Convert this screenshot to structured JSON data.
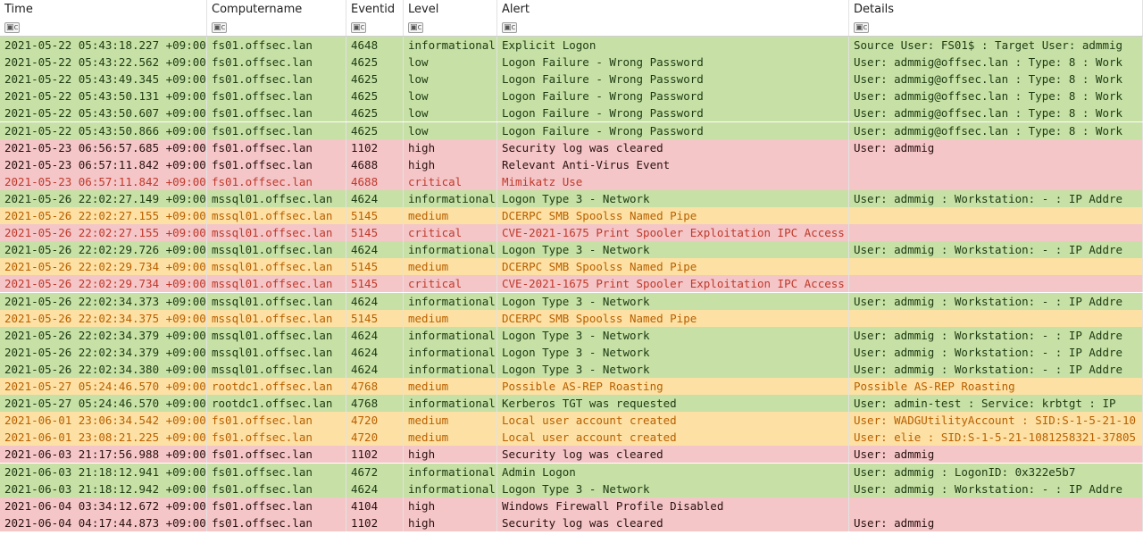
{
  "columns": [
    {
      "key": "time",
      "label": "Time"
    },
    {
      "key": "computer",
      "label": "Computername"
    },
    {
      "key": "eventid",
      "label": "Eventid"
    },
    {
      "key": "level",
      "label": "Level"
    },
    {
      "key": "alert",
      "label": "Alert"
    },
    {
      "key": "details",
      "label": "Details"
    }
  ],
  "filter_icon": "filter-icon",
  "level_colors": {
    "informational": {
      "bg": "#c6e0a5",
      "fg": "#1e3a12"
    },
    "low": {
      "bg": "#c6e0a5",
      "fg": "#1e3a12"
    },
    "high": {
      "bg": "#f4c6c8",
      "fg": "#2a1111"
    },
    "critical": {
      "bg": "#f4c6c8",
      "fg": "#c0392b"
    },
    "medium": {
      "bg": "#fde1a4",
      "fg": "#b85f00"
    }
  },
  "rows": [
    {
      "time": "2021-05-22 05:43:18.227 +09:00",
      "computer": "fs01.offsec.lan",
      "eventid": "4648",
      "level": "informational",
      "alert": "Explicit Logon",
      "details": "Source User: FS01$  :  Target User: admmig"
    },
    {
      "time": "2021-05-22 05:43:22.562 +09:00",
      "computer": "fs01.offsec.lan",
      "eventid": "4625",
      "level": "low",
      "alert": "Logon Failure - Wrong Password",
      "details": "User: admmig@offsec.lan  :  Type: 8  :  Work"
    },
    {
      "time": "2021-05-22 05:43:49.345 +09:00",
      "computer": "fs01.offsec.lan",
      "eventid": "4625",
      "level": "low",
      "alert": "Logon Failure - Wrong Password",
      "details": "User: admmig@offsec.lan  :  Type: 8  :  Work"
    },
    {
      "time": "2021-05-22 05:43:50.131 +09:00",
      "computer": "fs01.offsec.lan",
      "eventid": "4625",
      "level": "low",
      "alert": "Logon Failure - Wrong Password",
      "details": "User: admmig@offsec.lan  :  Type: 8  :  Work"
    },
    {
      "time": "2021-05-22 05:43:50.607 +09:00",
      "computer": "fs01.offsec.lan",
      "eventid": "4625",
      "level": "low",
      "alert": "Logon Failure - Wrong Password",
      "details": "User: admmig@offsec.lan  :  Type: 8  :  Work"
    },
    {
      "time": "2021-05-22 05:43:50.866 +09:00",
      "computer": "fs01.offsec.lan",
      "eventid": "4625",
      "level": "low",
      "alert": "Logon Failure - Wrong Password",
      "details": "User: admmig@offsec.lan  :  Type: 8  :  Work"
    },
    {
      "time": "2021-05-23 06:56:57.685 +09:00",
      "computer": "fs01.offsec.lan",
      "eventid": "1102",
      "level": "high",
      "alert": "Security log was cleared",
      "details": "User: admmig"
    },
    {
      "time": "2021-05-23 06:57:11.842 +09:00",
      "computer": "fs01.offsec.lan",
      "eventid": "4688",
      "level": "high",
      "alert": "Relevant Anti-Virus Event",
      "details": ""
    },
    {
      "time": "2021-05-23 06:57:11.842 +09:00",
      "computer": "fs01.offsec.lan",
      "eventid": "4688",
      "level": "critical",
      "alert": "Mimikatz Use",
      "details": ""
    },
    {
      "time": "2021-05-26 22:02:27.149 +09:00",
      "computer": "mssql01.offsec.lan",
      "eventid": "4624",
      "level": "informational",
      "alert": "Logon Type 3 - Network",
      "details": "User: admmig  :  Workstation: -  :  IP Addre"
    },
    {
      "time": "2021-05-26 22:02:27.155 +09:00",
      "computer": "mssql01.offsec.lan",
      "eventid": "5145",
      "level": "medium",
      "alert": "DCERPC SMB Spoolss Named Pipe",
      "details": ""
    },
    {
      "time": "2021-05-26 22:02:27.155 +09:00",
      "computer": "mssql01.offsec.lan",
      "eventid": "5145",
      "level": "critical",
      "alert": "CVE-2021-1675 Print Spooler Exploitation IPC Access",
      "details": ""
    },
    {
      "time": "2021-05-26 22:02:29.726 +09:00",
      "computer": "mssql01.offsec.lan",
      "eventid": "4624",
      "level": "informational",
      "alert": "Logon Type 3 - Network",
      "details": "User: admmig  :  Workstation: -  :  IP Addre"
    },
    {
      "time": "2021-05-26 22:02:29.734 +09:00",
      "computer": "mssql01.offsec.lan",
      "eventid": "5145",
      "level": "medium",
      "alert": "DCERPC SMB Spoolss Named Pipe",
      "details": ""
    },
    {
      "time": "2021-05-26 22:02:29.734 +09:00",
      "computer": "mssql01.offsec.lan",
      "eventid": "5145",
      "level": "critical",
      "alert": "CVE-2021-1675 Print Spooler Exploitation IPC Access",
      "details": ""
    },
    {
      "time": "2021-05-26 22:02:34.373 +09:00",
      "computer": "mssql01.offsec.lan",
      "eventid": "4624",
      "level": "informational",
      "alert": "Logon Type 3 - Network",
      "details": "User: admmig  :  Workstation: -  :  IP Addre"
    },
    {
      "time": "2021-05-26 22:02:34.375 +09:00",
      "computer": "mssql01.offsec.lan",
      "eventid": "5145",
      "level": "medium",
      "alert": "DCERPC SMB Spoolss Named Pipe",
      "details": ""
    },
    {
      "time": "2021-05-26 22:02:34.379 +09:00",
      "computer": "mssql01.offsec.lan",
      "eventid": "4624",
      "level": "informational",
      "alert": "Logon Type 3 - Network",
      "details": "User: admmig  :  Workstation: -  :  IP Addre"
    },
    {
      "time": "2021-05-26 22:02:34.379 +09:00",
      "computer": "mssql01.offsec.lan",
      "eventid": "4624",
      "level": "informational",
      "alert": "Logon Type 3 - Network",
      "details": "User: admmig  :  Workstation: -  :  IP Addre"
    },
    {
      "time": "2021-05-26 22:02:34.380 +09:00",
      "computer": "mssql01.offsec.lan",
      "eventid": "4624",
      "level": "informational",
      "alert": "Logon Type 3 - Network",
      "details": "User: admmig  :  Workstation: -  :  IP Addre"
    },
    {
      "time": "2021-05-27 05:24:46.570 +09:00",
      "computer": "rootdc1.offsec.lan",
      "eventid": "4768",
      "level": "medium",
      "alert": "Possible AS-REP Roasting",
      "details": "Possible AS-REP Roasting"
    },
    {
      "time": "2021-05-27 05:24:46.570 +09:00",
      "computer": "rootdc1.offsec.lan",
      "eventid": "4768",
      "level": "informational",
      "alert": "Kerberos TGT was requested",
      "details": "User: admin-test  :  Service: krbtgt  :  IP"
    },
    {
      "time": "2021-06-01 23:06:34.542 +09:00",
      "computer": "fs01.offsec.lan",
      "eventid": "4720",
      "level": "medium",
      "alert": "Local user account created",
      "details": "User: WADGUtilityAccount  :  SID:S-1-5-21-10"
    },
    {
      "time": "2021-06-01 23:08:21.225 +09:00",
      "computer": "fs01.offsec.lan",
      "eventid": "4720",
      "level": "medium",
      "alert": "Local user account created",
      "details": "User: elie  :  SID:S-1-5-21-1081258321-37805"
    },
    {
      "time": "2021-06-03 21:17:56.988 +09:00",
      "computer": "fs01.offsec.lan",
      "eventid": "1102",
      "level": "high",
      "alert": "Security log was cleared",
      "details": "User: admmig"
    },
    {
      "time": "2021-06-03 21:18:12.941 +09:00",
      "computer": "fs01.offsec.lan",
      "eventid": "4672",
      "level": "informational",
      "alert": "Admin Logon",
      "details": "User: admmig  :  LogonID: 0x322e5b7"
    },
    {
      "time": "2021-06-03 21:18:12.942 +09:00",
      "computer": "fs01.offsec.lan",
      "eventid": "4624",
      "level": "informational",
      "alert": "Logon Type 3 - Network",
      "details": "User: admmig  :  Workstation: -  :  IP Addre"
    },
    {
      "time": "2021-06-04 03:34:12.672 +09:00",
      "computer": "fs01.offsec.lan",
      "eventid": "4104",
      "level": "high",
      "alert": "Windows Firewall Profile Disabled",
      "details": ""
    },
    {
      "time": "2021-06-04 04:17:44.873 +09:00",
      "computer": "fs01.offsec.lan",
      "eventid": "1102",
      "level": "high",
      "alert": "Security log was cleared",
      "details": "User: admmig"
    }
  ]
}
